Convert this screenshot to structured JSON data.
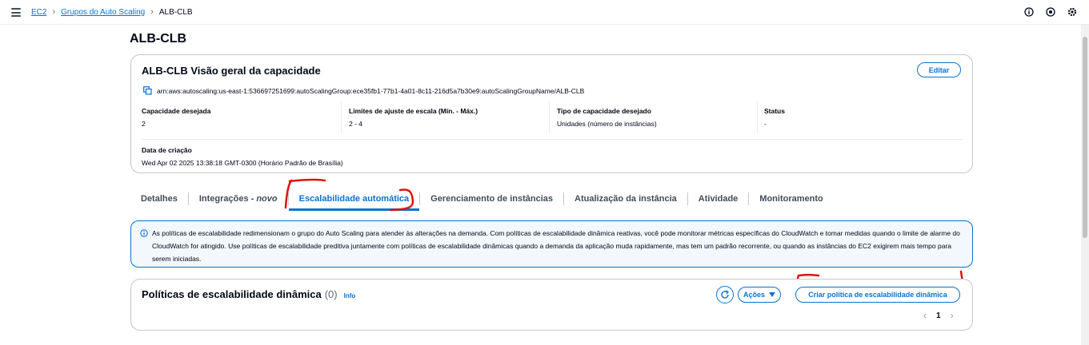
{
  "breadcrumb": {
    "items": [
      "EC2",
      "Grupos do Auto Scaling"
    ],
    "current": "ALB-CLB"
  },
  "page": {
    "title": "ALB-CLB"
  },
  "overview": {
    "title": "ALB-CLB Visão geral da capacidade",
    "edit_label": "Editar",
    "arn": "arn:aws:autoscaling:us-east-1:536697251699:autoScalingGroup:ece35fb1-77b1-4a01-8c11-216d5a7b30e9:autoScalingGroupName/ALB-CLB",
    "fields": [
      {
        "label": "Capacidade desejada",
        "value": "2"
      },
      {
        "label": "Limites de ajuste de escala (Mín. - Máx.)",
        "value": "2 - 4"
      },
      {
        "label": "Tipo de capacidade desejado",
        "value": "Unidades (número de instâncias)"
      },
      {
        "label": "Status",
        "value": "-"
      }
    ],
    "created": {
      "label": "Data de criação",
      "value": "Wed Apr 02 2025 13:38:18 GMT-0300 (Horário Padrão de Brasília)"
    }
  },
  "tabs": [
    {
      "label": "Detalhes"
    },
    {
      "label": "Integrações",
      "badge": "- novo"
    },
    {
      "label": "Escalabilidade automática",
      "active": true
    },
    {
      "label": "Gerenciamento de instâncias"
    },
    {
      "label": "Atualização da instância"
    },
    {
      "label": "Atividade"
    },
    {
      "label": "Monitoramento"
    }
  ],
  "info_alert": {
    "text": "As políticas de escalabilidade redimensionam o grupo do Auto Scaling para atender às alterações na demanda. Com políticas de escalabilidade dinâmica reativas, você pode monitorar métricas específicas do CloudWatch e tomar medidas quando o limite de alarme do CloudWatch for atingido. Use políticas de escalabilidade preditiva juntamente com políticas de escalabilidade dinâmicas quando a demanda da aplicação muda rapidamente, mas tem um padrão recorrente, ou quando as instâncias do EC2 exigirem mais tempo para serem iniciadas."
  },
  "policies": {
    "title": "Políticas de escalabilidade dinâmica",
    "count": "(0)",
    "info_label": "Info",
    "actions_label": "Ações",
    "create_label": "Criar política de escalabilidade dinâmica",
    "page_number": "1"
  },
  "colors": {
    "accent": "#0972d3",
    "annotation": "#e0120f"
  },
  "icons": [
    "menu-icon",
    "info-icon",
    "notifications-icon",
    "settings-icon",
    "copy-icon",
    "refresh-icon",
    "caret-down-icon",
    "chevron-left-icon",
    "chevron-right-icon"
  ]
}
